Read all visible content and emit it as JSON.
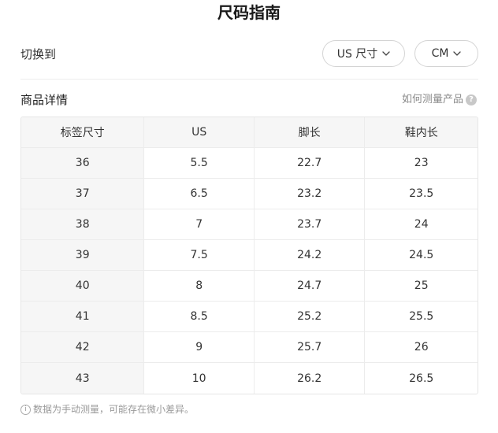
{
  "title": "尺码指南",
  "switch": {
    "label": "切换到",
    "unit_dropdown": "US 尺寸",
    "measure_dropdown": "CM"
  },
  "section": {
    "title": "商品详情",
    "how_to_measure": "如何测量产品",
    "help_icon": "?"
  },
  "table": {
    "headers": [
      "标签尺寸",
      "US",
      "脚长",
      "鞋内长"
    ],
    "rows": [
      [
        "36",
        "5.5",
        "22.7",
        "23"
      ],
      [
        "37",
        "6.5",
        "23.2",
        "23.5"
      ],
      [
        "38",
        "7",
        "23.7",
        "24"
      ],
      [
        "39",
        "7.5",
        "24.2",
        "24.5"
      ],
      [
        "40",
        "8",
        "24.7",
        "25"
      ],
      [
        "41",
        "8.5",
        "25.2",
        "25.5"
      ],
      [
        "42",
        "9",
        "25.7",
        "26"
      ],
      [
        "43",
        "10",
        "26.2",
        "26.5"
      ]
    ]
  },
  "footnote": {
    "icon": "i",
    "text": "数据为手动测量，可能存在微小差异。"
  }
}
